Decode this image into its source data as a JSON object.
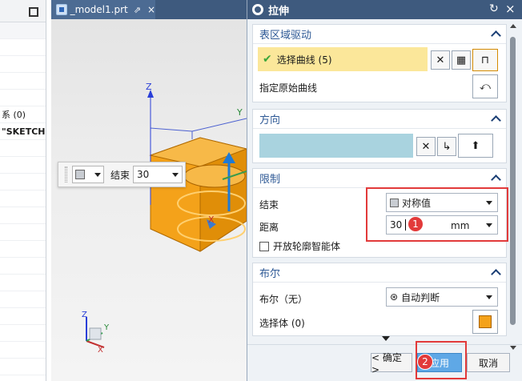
{
  "navigator": {
    "rows": [
      "",
      "",
      "",
      "",
      "",
      "系 (0)",
      "\"SKETCH",
      "",
      "",
      "",
      "",
      "",
      "",
      "",
      "",
      "",
      "",
      "",
      "",
      "",
      ""
    ]
  },
  "tab": {
    "title": "_model1.prt",
    "pin": "⇗",
    "close": "×"
  },
  "viewport": {
    "axis_z": "Z",
    "axis_y": "Y",
    "axis_x": "X",
    "mini_axis_z": "Z",
    "mini_axis_y": "Y",
    "mini_axis_x": "X"
  },
  "floatbar": {
    "end_label": "结束",
    "end_value": "30"
  },
  "dialog": {
    "title": "拉伸",
    "sections": {
      "section": {
        "title": "表区域驱动",
        "select_curve": "选择曲线 (5)",
        "specify_origin": "指定原始曲线"
      },
      "direction": {
        "title": "方向"
      },
      "limits": {
        "title": "限制",
        "end_label": "结束",
        "end_option": "对称值",
        "distance_label": "距离",
        "distance_value": "30",
        "distance_unit": "mm",
        "open_profile": "开放轮廓智能体"
      },
      "boolean": {
        "title": "布尔",
        "boolean_label": "布尔（无）",
        "boolean_option": "自动判断",
        "select_body": "选择体 (0)"
      }
    },
    "footer": {
      "ok": "< 确定 >",
      "apply": "应用",
      "cancel": "取消"
    },
    "badges": {
      "first": "1",
      "second": "2"
    }
  },
  "colors": {
    "title_bar": "#3e5a7e",
    "section_header": "#2f5a96",
    "highlight_yellow": "#fbe79a",
    "direction_blue": "#a9d3df",
    "annotation_red": "#e23a3a",
    "model_orange": "#f4a21a"
  }
}
